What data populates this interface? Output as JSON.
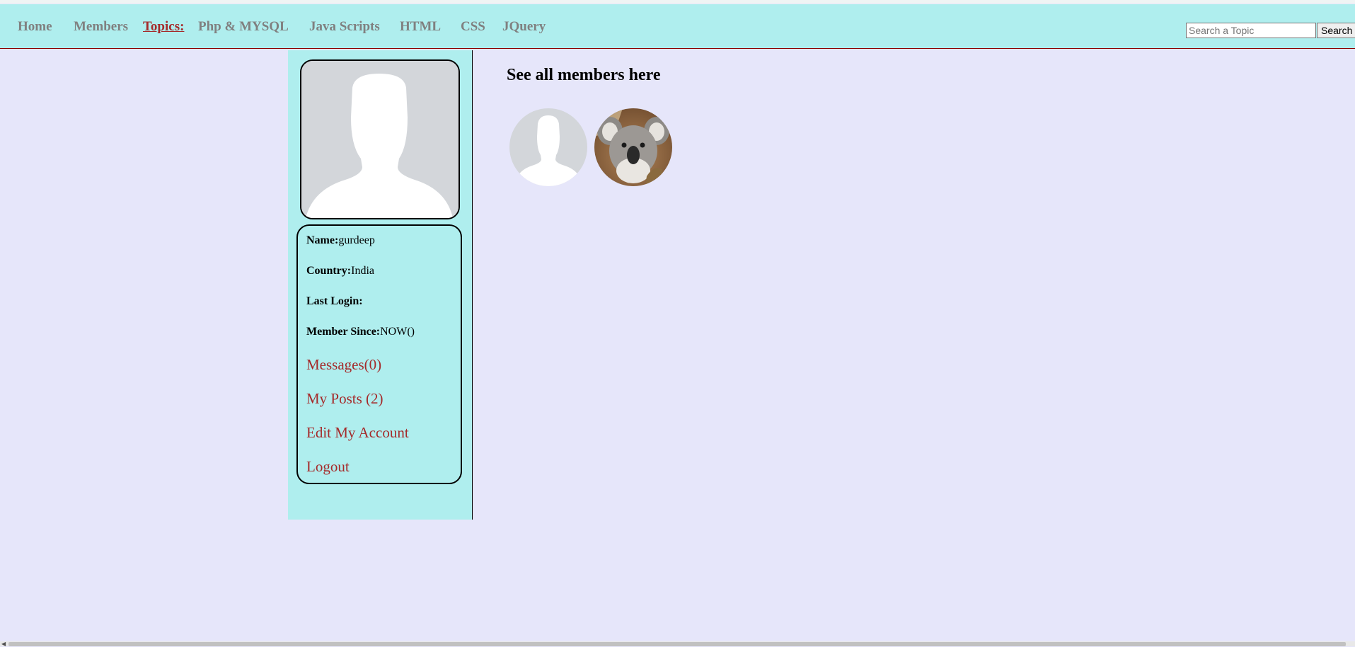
{
  "nav": {
    "home": "Home",
    "members": "Members",
    "topics": "Topics:",
    "php_mysql": "Php & MYSQL",
    "javascripts": "Java Scripts",
    "html": "HTML",
    "css": "CSS",
    "jquery": "JQuery"
  },
  "search": {
    "placeholder": "Search a Topic",
    "value": "",
    "button_label": "Search"
  },
  "profile": {
    "name_label": "Name:",
    "name_value": "gurdeep",
    "country_label": "Country:",
    "country_value": "India",
    "last_login_label": "Last Login:",
    "last_login_value": "",
    "member_since_label": "Member Since:",
    "member_since_value": "NOW()"
  },
  "sidebar_links": {
    "messages": "Messages(0)",
    "my_posts": "My Posts (2)",
    "edit_account": "Edit My Account",
    "logout": "Logout"
  },
  "main": {
    "heading": "See all members here",
    "members": [
      {
        "avatar_icon": "default-user-silhouette-icon"
      },
      {
        "avatar_icon": "koala-photo"
      }
    ]
  },
  "colors": {
    "nav_bg": "#afeeee",
    "page_bg": "#e6e6fa",
    "link": "#a52a2a",
    "nav_text": "#808080"
  }
}
